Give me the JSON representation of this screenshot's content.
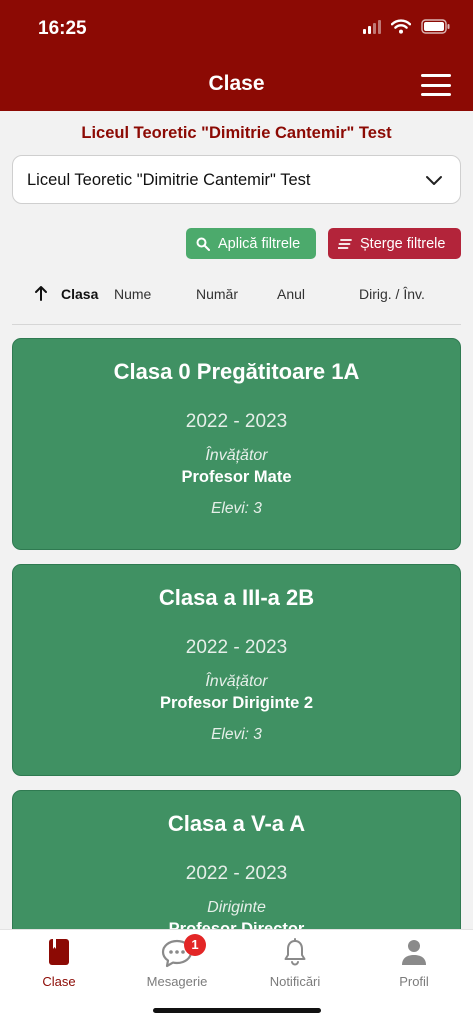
{
  "status": {
    "time": "16:25"
  },
  "header": {
    "title": "Clase"
  },
  "school": {
    "title": "Liceul Teoretic \"Dimitrie Cantemir\" Test",
    "selected": "Liceul Teoretic \"Dimitrie Cantemir\" Test"
  },
  "filters": {
    "apply_label": "Aplică filtrele",
    "clear_label": "Șterge filtrele"
  },
  "sort": {
    "columns": [
      "Clasa",
      "Nume",
      "Număr",
      "Anul",
      "Dirig. / Înv."
    ],
    "active": "Clasa"
  },
  "classes": [
    {
      "name": "Clasa 0 Pregătitoare 1A",
      "year": "2022 - 2023",
      "role": "Învățător",
      "teacher": "Profesor Mate",
      "students": "Elevi: 3"
    },
    {
      "name": "Clasa a III-a 2B",
      "year": "2022 - 2023",
      "role": "Învățător",
      "teacher": "Profesor Diriginte 2",
      "students": "Elevi: 3"
    },
    {
      "name": "Clasa a V-a A",
      "year": "2022 - 2023",
      "role": "Diriginte",
      "teacher": "Profesor Director",
      "students": ""
    }
  ],
  "tabs": [
    {
      "label": "Clase",
      "icon": "book-icon"
    },
    {
      "label": "Mesagerie",
      "icon": "chat-icon",
      "badge": "1"
    },
    {
      "label": "Notificări",
      "icon": "bell-icon"
    },
    {
      "label": "Profil",
      "icon": "person-icon"
    }
  ],
  "colors": {
    "primary": "#8c0a04",
    "card": "#409163",
    "apply": "#4caa6c",
    "clear": "#b3243a",
    "badge": "#e32626"
  }
}
